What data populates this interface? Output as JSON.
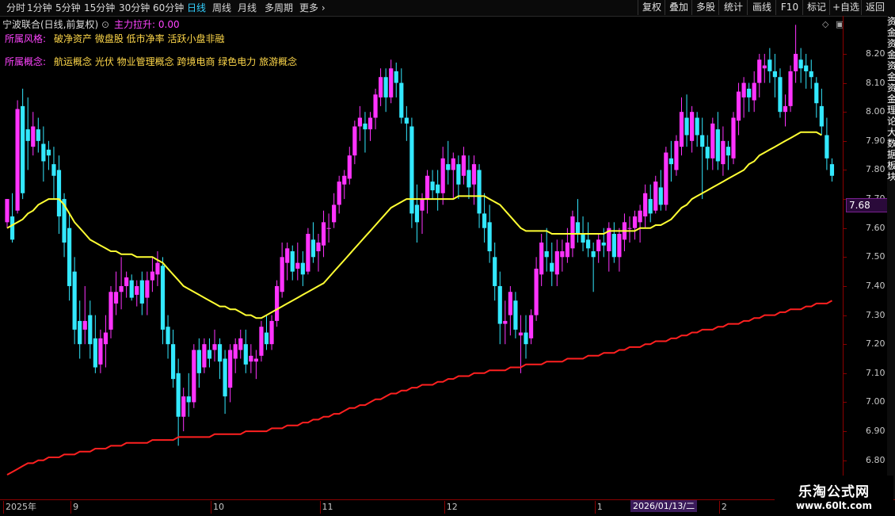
{
  "toolbar": {
    "periods": [
      "分时",
      "1分钟",
      "5分钟",
      "15分钟",
      "30分钟",
      "60分钟",
      "日线",
      "周线",
      "月线",
      "多周期",
      "更多"
    ],
    "active": "日线",
    "right_buttons": [
      "复权",
      "叠加",
      "多股",
      "统计",
      "画线",
      "F10",
      "标记",
      "+自选",
      "返回"
    ]
  },
  "header": {
    "stock_title": "宁波联合(日线,前复权)",
    "main_force_label": "主力拉升:",
    "main_force_value": "0.00",
    "style_label": "所属风格:",
    "style_values": "破净资产 微盘股 低市净率 活跃小盘非融",
    "concept_label": "所属概念:",
    "concept_values": "航运概念 光伏 物业管理概念 跨境电商 绿色电力 旅游概念"
  },
  "side_strip_text": "资金资金资金资金理论大数据板块",
  "colors": {
    "up": "#ff33ff",
    "down": "#33e8ff",
    "ma_short": "#ffff33",
    "ma_long": "#ff2020",
    "grid": "#8b0000"
  },
  "watermark": {
    "line1": "乐淘公式网",
    "line2": "www.60lt.com"
  },
  "last_price_tag": "7.68",
  "date_flag": "2026/01/13/二",
  "chart_data": {
    "type": "candlestick",
    "ylim": [
      6.72,
      8.32
    ],
    "yticks": [
      "8.20",
      "8.10",
      "8.00",
      "7.90",
      "7.80",
      "7.70",
      "7.60",
      "7.50",
      "7.40",
      "7.30",
      "7.20",
      "7.10",
      "7.00",
      "6.90",
      "6.80"
    ],
    "x_labels": [
      "2025年",
      "9",
      "10",
      "11",
      "12",
      "1",
      "2"
    ],
    "candles": [
      [
        7.62,
        7.7,
        7.6,
        7.7
      ],
      [
        7.64,
        7.72,
        7.55,
        7.56
      ],
      [
        7.66,
        8.04,
        7.65,
        8.01
      ],
      [
        8.02,
        8.08,
        7.7,
        7.72
      ],
      [
        7.94,
        8.05,
        7.8,
        7.9
      ],
      [
        7.88,
        8.0,
        7.85,
        7.95
      ],
      [
        7.94,
        7.98,
        7.86,
        7.9
      ],
      [
        7.89,
        7.95,
        7.76,
        7.83
      ],
      [
        7.87,
        7.9,
        7.8,
        7.85
      ],
      [
        7.82,
        7.88,
        7.7,
        7.78
      ],
      [
        7.8,
        7.85,
        7.58,
        7.64
      ],
      [
        7.7,
        7.72,
        7.5,
        7.55
      ],
      [
        7.6,
        7.65,
        7.35,
        7.4
      ],
      [
        7.45,
        7.5,
        7.2,
        7.25
      ],
      [
        7.28,
        7.35,
        7.15,
        7.2
      ],
      [
        7.25,
        7.4,
        7.2,
        7.28
      ],
      [
        7.3,
        7.35,
        7.15,
        7.2
      ],
      [
        7.22,
        7.3,
        7.1,
        7.12
      ],
      [
        7.13,
        7.25,
        7.1,
        7.22
      ],
      [
        7.2,
        7.3,
        7.12,
        7.24
      ],
      [
        7.25,
        7.4,
        7.22,
        7.38
      ],
      [
        7.34,
        7.45,
        7.3,
        7.38
      ],
      [
        7.38,
        7.5,
        7.32,
        7.4
      ],
      [
        7.4,
        7.45,
        7.36,
        7.43
      ],
      [
        7.42,
        7.44,
        7.35,
        7.36
      ],
      [
        7.37,
        7.42,
        7.33,
        7.4
      ],
      [
        7.42,
        7.45,
        7.3,
        7.34
      ],
      [
        7.36,
        7.45,
        7.3,
        7.42
      ],
      [
        7.42,
        7.5,
        7.38,
        7.45
      ],
      [
        7.44,
        7.52,
        7.4,
        7.48
      ],
      [
        7.47,
        7.5,
        7.2,
        7.25
      ],
      [
        7.26,
        7.3,
        7.15,
        7.2
      ],
      [
        7.2,
        7.25,
        7.05,
        7.08
      ],
      [
        7.1,
        7.15,
        6.85,
        6.95
      ],
      [
        6.95,
        7.05,
        6.9,
        7.02
      ],
      [
        7.02,
        7.1,
        6.95,
        7.0
      ],
      [
        7.0,
        7.2,
        6.98,
        7.18
      ],
      [
        7.18,
        7.22,
        7.05,
        7.1
      ],
      [
        7.12,
        7.22,
        7.1,
        7.2
      ],
      [
        7.18,
        7.22,
        7.12,
        7.15
      ],
      [
        7.18,
        7.25,
        7.14,
        7.2
      ],
      [
        7.2,
        7.22,
        7.08,
        7.14
      ],
      [
        7.15,
        7.18,
        6.96,
        7.02
      ],
      [
        7.05,
        7.2,
        7.0,
        7.18
      ],
      [
        7.15,
        7.22,
        7.1,
        7.2
      ],
      [
        7.18,
        7.25,
        7.15,
        7.22
      ],
      [
        7.2,
        7.25,
        7.1,
        7.13
      ],
      [
        7.14,
        7.2,
        7.1,
        7.16
      ],
      [
        7.14,
        7.18,
        7.08,
        7.15
      ],
      [
        7.16,
        7.28,
        7.14,
        7.26
      ],
      [
        7.24,
        7.3,
        7.18,
        7.2
      ],
      [
        7.2,
        7.3,
        7.18,
        7.28
      ],
      [
        7.28,
        7.42,
        7.26,
        7.4
      ],
      [
        7.38,
        7.55,
        7.36,
        7.5
      ],
      [
        7.48,
        7.55,
        7.42,
        7.53
      ],
      [
        7.52,
        7.54,
        7.42,
        7.45
      ],
      [
        7.46,
        7.55,
        7.42,
        7.48
      ],
      [
        7.48,
        7.52,
        7.4,
        7.44
      ],
      [
        7.45,
        7.6,
        7.44,
        7.58
      ],
      [
        7.56,
        7.62,
        7.48,
        7.5
      ],
      [
        7.52,
        7.58,
        7.45,
        7.55
      ],
      [
        7.54,
        7.66,
        7.5,
        7.62
      ],
      [
        7.6,
        7.65,
        7.55,
        7.6
      ],
      [
        7.62,
        7.72,
        7.6,
        7.68
      ],
      [
        7.68,
        7.78,
        7.65,
        7.76
      ],
      [
        7.75,
        7.8,
        7.7,
        7.78
      ],
      [
        7.77,
        7.88,
        7.75,
        7.85
      ],
      [
        7.85,
        7.97,
        7.82,
        7.95
      ],
      [
        7.95,
        8.02,
        7.9,
        7.98
      ],
      [
        7.96,
        8.0,
        7.86,
        7.94
      ],
      [
        7.94,
        8.0,
        7.9,
        7.98
      ],
      [
        7.98,
        8.08,
        7.94,
        8.06
      ],
      [
        8.05,
        8.15,
        8.02,
        8.12
      ],
      [
        8.12,
        8.15,
        8.0,
        8.05
      ],
      [
        8.05,
        8.18,
        8.03,
        8.15
      ],
      [
        8.14,
        8.17,
        8.05,
        8.1
      ],
      [
        8.1,
        8.15,
        7.96,
        7.98
      ],
      [
        7.98,
        8.02,
        7.9,
        7.96
      ],
      [
        7.95,
        7.98,
        7.6,
        7.65
      ],
      [
        7.68,
        7.75,
        7.55,
        7.62
      ],
      [
        7.66,
        7.72,
        7.58,
        7.7
      ],
      [
        7.7,
        7.8,
        7.65,
        7.78
      ],
      [
        7.76,
        7.8,
        7.7,
        7.73
      ],
      [
        7.75,
        7.8,
        7.66,
        7.72
      ],
      [
        7.72,
        7.88,
        7.68,
        7.84
      ],
      [
        7.82,
        7.9,
        7.75,
        7.8
      ],
      [
        7.8,
        7.86,
        7.7,
        7.84
      ],
      [
        7.82,
        7.85,
        7.7,
        7.75
      ],
      [
        7.78,
        7.88,
        7.75,
        7.85
      ],
      [
        7.8,
        7.85,
        7.7,
        7.74
      ],
      [
        7.75,
        7.85,
        7.68,
        7.82
      ],
      [
        7.8,
        7.82,
        7.6,
        7.65
      ],
      [
        7.65,
        7.72,
        7.55,
        7.6
      ],
      [
        7.62,
        7.68,
        7.48,
        7.52
      ],
      [
        7.5,
        7.55,
        7.35,
        7.4
      ],
      [
        7.4,
        7.45,
        7.2,
        7.27
      ],
      [
        7.27,
        7.35,
        7.2,
        7.28
      ],
      [
        7.3,
        7.4,
        7.23,
        7.38
      ],
      [
        7.35,
        7.38,
        7.22,
        7.25
      ],
      [
        7.23,
        7.3,
        7.1,
        7.24
      ],
      [
        7.24,
        7.3,
        7.15,
        7.2
      ],
      [
        7.22,
        7.32,
        7.2,
        7.3
      ],
      [
        7.3,
        7.5,
        7.28,
        7.46
      ],
      [
        7.44,
        7.58,
        7.4,
        7.55
      ],
      [
        7.52,
        7.6,
        7.45,
        7.5
      ],
      [
        7.48,
        7.55,
        7.4,
        7.45
      ],
      [
        7.44,
        7.56,
        7.4,
        7.52
      ],
      [
        7.5,
        7.56,
        7.45,
        7.52
      ],
      [
        7.5,
        7.6,
        7.48,
        7.55
      ],
      [
        7.53,
        7.66,
        7.5,
        7.64
      ],
      [
        7.62,
        7.7,
        7.55,
        7.58
      ],
      [
        7.58,
        7.64,
        7.52,
        7.55
      ],
      [
        7.56,
        7.62,
        7.5,
        7.53
      ],
      [
        7.52,
        7.55,
        7.38,
        7.5
      ],
      [
        7.52,
        7.58,
        7.48,
        7.56
      ],
      [
        7.55,
        7.6,
        7.5,
        7.54
      ],
      [
        7.52,
        7.62,
        7.45,
        7.6
      ],
      [
        7.58,
        7.62,
        7.48,
        7.5
      ],
      [
        7.5,
        7.6,
        7.45,
        7.58
      ],
      [
        7.56,
        7.65,
        7.52,
        7.62
      ],
      [
        7.6,
        7.64,
        7.55,
        7.6
      ],
      [
        7.6,
        7.66,
        7.56,
        7.64
      ],
      [
        7.62,
        7.68,
        7.55,
        7.66
      ],
      [
        7.64,
        7.75,
        7.6,
        7.72
      ],
      [
        7.7,
        7.75,
        7.62,
        7.65
      ],
      [
        7.66,
        7.78,
        7.65,
        7.76
      ],
      [
        7.74,
        7.8,
        7.66,
        7.68
      ],
      [
        7.68,
        7.88,
        7.66,
        7.86
      ],
      [
        7.84,
        7.9,
        7.76,
        7.82
      ],
      [
        7.8,
        7.92,
        7.78,
        7.9
      ],
      [
        7.88,
        8.05,
        7.85,
        8.0
      ],
      [
        7.98,
        8.06,
        7.88,
        7.92
      ],
      [
        7.9,
        8.02,
        7.86,
        8.0
      ],
      [
        7.98,
        8.0,
        7.88,
        7.92
      ],
      [
        7.92,
        7.98,
        7.7,
        7.88
      ],
      [
        7.88,
        7.92,
        7.8,
        7.84
      ],
      [
        7.84,
        7.98,
        7.8,
        7.96
      ],
      [
        7.94,
        8.0,
        7.8,
        7.83
      ],
      [
        7.82,
        7.95,
        7.78,
        7.9
      ],
      [
        7.88,
        7.9,
        7.8,
        7.85
      ],
      [
        7.84,
        8.0,
        7.82,
        7.98
      ],
      [
        7.97,
        8.1,
        7.92,
        8.07
      ],
      [
        8.05,
        8.12,
        7.98,
        8.1
      ],
      [
        8.08,
        8.1,
        8.0,
        8.05
      ],
      [
        8.04,
        8.14,
        8.0,
        8.1
      ],
      [
        8.1,
        8.2,
        8.05,
        8.18
      ],
      [
        8.15,
        8.2,
        8.1,
        8.16
      ],
      [
        8.18,
        8.22,
        8.1,
        8.14
      ],
      [
        8.14,
        8.2,
        8.05,
        8.12
      ],
      [
        8.12,
        8.15,
        7.98,
        8.0
      ],
      [
        8.0,
        8.06,
        7.95,
        8.02
      ],
      [
        8.02,
        8.16,
        8.0,
        8.14
      ],
      [
        8.14,
        8.3,
        8.1,
        8.2
      ],
      [
        8.18,
        8.22,
        8.1,
        8.15
      ],
      [
        8.16,
        8.2,
        8.08,
        8.14
      ],
      [
        8.14,
        8.18,
        8.08,
        8.12
      ],
      [
        8.1,
        8.12,
        7.98,
        8.03
      ],
      [
        8.02,
        8.08,
        7.92,
        7.95
      ],
      [
        7.92,
        7.98,
        7.8,
        7.84
      ],
      [
        7.82,
        7.84,
        7.76,
        7.78
      ]
    ],
    "ma_short": [
      7.6,
      7.61,
      7.62,
      7.63,
      7.65,
      7.66,
      7.68,
      7.69,
      7.7,
      7.7,
      7.7,
      7.68,
      7.65,
      7.62,
      7.6,
      7.58,
      7.56,
      7.55,
      7.54,
      7.53,
      7.52,
      7.52,
      7.51,
      7.51,
      7.51,
      7.5,
      7.5,
      7.5,
      7.5,
      7.49,
      7.48,
      7.46,
      7.44,
      7.42,
      7.4,
      7.39,
      7.38,
      7.37,
      7.36,
      7.35,
      7.34,
      7.33,
      7.33,
      7.32,
      7.32,
      7.31,
      7.3,
      7.3,
      7.29,
      7.29,
      7.3,
      7.31,
      7.32,
      7.33,
      7.34,
      7.35,
      7.36,
      7.37,
      7.38,
      7.39,
      7.4,
      7.41,
      7.43,
      7.45,
      7.47,
      7.49,
      7.51,
      7.53,
      7.55,
      7.57,
      7.59,
      7.61,
      7.63,
      7.65,
      7.67,
      7.68,
      7.69,
      7.7,
      7.7,
      7.7,
      7.7,
      7.7,
      7.7,
      7.7,
      7.7,
      7.7,
      7.7,
      7.71,
      7.71,
      7.71,
      7.71,
      7.71,
      7.71,
      7.7,
      7.69,
      7.68,
      7.66,
      7.64,
      7.62,
      7.6,
      7.59,
      7.59,
      7.59,
      7.59,
      7.59,
      7.58,
      7.58,
      7.58,
      7.58,
      7.58,
      7.58,
      7.58,
      7.58,
      7.58,
      7.58,
      7.58,
      7.59,
      7.59,
      7.59,
      7.59,
      7.59,
      7.59,
      7.6,
      7.6,
      7.6,
      7.61,
      7.61,
      7.62,
      7.63,
      7.65,
      7.67,
      7.68,
      7.7,
      7.71,
      7.72,
      7.73,
      7.74,
      7.75,
      7.76,
      7.77,
      7.78,
      7.79,
      7.8,
      7.82,
      7.83,
      7.85,
      7.86,
      7.87,
      7.88,
      7.89,
      7.9,
      7.91,
      7.92,
      7.93,
      7.93,
      7.93,
      7.93,
      7.92
    ],
    "ma_long": [
      6.75,
      6.76,
      6.77,
      6.78,
      6.79,
      6.79,
      6.8,
      6.8,
      6.81,
      6.81,
      6.81,
      6.82,
      6.82,
      6.82,
      6.83,
      6.83,
      6.83,
      6.84,
      6.84,
      6.84,
      6.85,
      6.85,
      6.85,
      6.86,
      6.86,
      6.86,
      6.86,
      6.86,
      6.87,
      6.87,
      6.87,
      6.87,
      6.87,
      6.88,
      6.88,
      6.88,
      6.88,
      6.88,
      6.88,
      6.88,
      6.89,
      6.89,
      6.89,
      6.89,
      6.89,
      6.89,
      6.9,
      6.9,
      6.9,
      6.9,
      6.9,
      6.91,
      6.91,
      6.91,
      6.92,
      6.92,
      6.92,
      6.93,
      6.93,
      6.94,
      6.94,
      6.95,
      6.95,
      6.96,
      6.96,
      6.97,
      6.98,
      6.98,
      6.99,
      6.99,
      7.0,
      7.01,
      7.01,
      7.02,
      7.03,
      7.03,
      7.04,
      7.04,
      7.05,
      7.05,
      7.06,
      7.06,
      7.06,
      7.07,
      7.07,
      7.08,
      7.08,
      7.09,
      7.09,
      7.09,
      7.1,
      7.1,
      7.1,
      7.11,
      7.11,
      7.11,
      7.11,
      7.12,
      7.12,
      7.12,
      7.13,
      7.13,
      7.13,
      7.13,
      7.14,
      7.14,
      7.14,
      7.14,
      7.15,
      7.15,
      7.15,
      7.15,
      7.16,
      7.16,
      7.16,
      7.17,
      7.17,
      7.17,
      7.18,
      7.18,
      7.19,
      7.19,
      7.19,
      7.2,
      7.2,
      7.21,
      7.21,
      7.21,
      7.22,
      7.22,
      7.23,
      7.23,
      7.24,
      7.24,
      7.25,
      7.25,
      7.25,
      7.26,
      7.26,
      7.27,
      7.27,
      7.27,
      7.28,
      7.28,
      7.29,
      7.29,
      7.3,
      7.3,
      7.3,
      7.31,
      7.31,
      7.32,
      7.32,
      7.32,
      7.33,
      7.33,
      7.34,
      7.34,
      7.34,
      7.35
    ]
  }
}
